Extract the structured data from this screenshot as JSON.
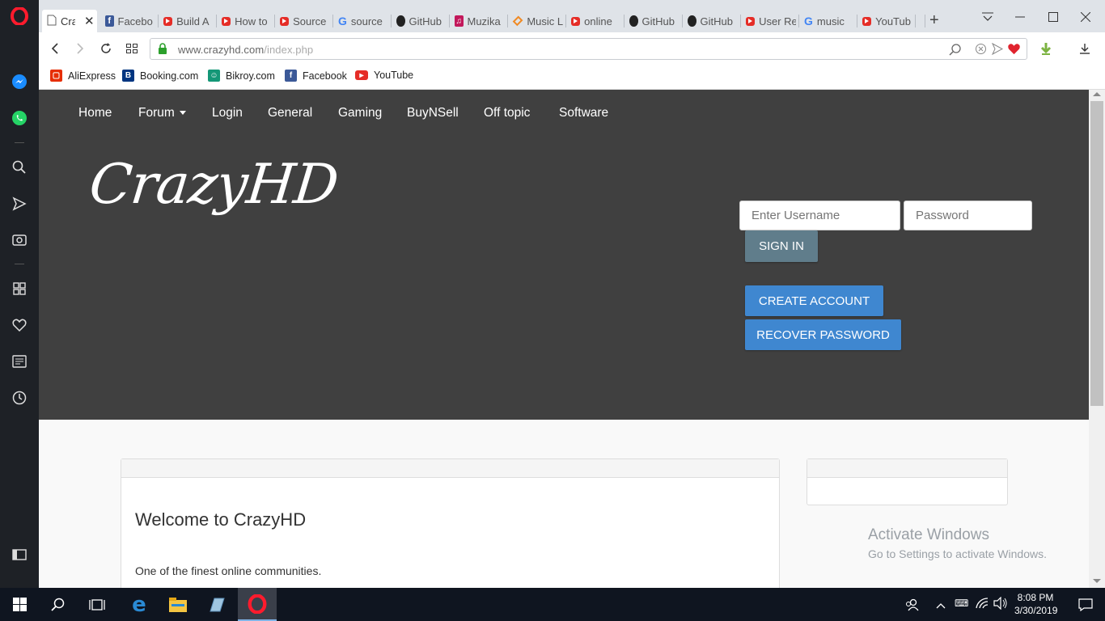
{
  "browser": {
    "tabs": [
      {
        "label": "Cra",
        "icon": "page-icon",
        "active": true
      },
      {
        "label": "Facebo",
        "icon": "facebook-icon"
      },
      {
        "label": "Build A",
        "icon": "youtube-icon"
      },
      {
        "label": "How to",
        "icon": "youtube-icon"
      },
      {
        "label": "Source",
        "icon": "youtube-icon"
      },
      {
        "label": "source",
        "icon": "google-icon"
      },
      {
        "label": "GitHub",
        "icon": "github-icon"
      },
      {
        "label": "Muzika",
        "icon": "music-icon"
      },
      {
        "label": "Music L",
        "icon": "music-diamond-icon"
      },
      {
        "label": "online",
        "icon": "youtube-icon"
      },
      {
        "label": "GitHub",
        "icon": "github-icon"
      },
      {
        "label": "GitHub",
        "icon": "github-icon"
      },
      {
        "label": "User Re",
        "icon": "youtube-icon"
      },
      {
        "label": "music",
        "icon": "google-icon"
      },
      {
        "label": "YouTub",
        "icon": "youtube-icon"
      }
    ],
    "new_tab_glyph": "+",
    "url_host": "www.crazyhd.com",
    "url_path": "/index.php",
    "bookmarks": [
      {
        "label": "AliExpress",
        "icon": "aliexpress-icon",
        "color": "#e62e04"
      },
      {
        "label": "Booking.com",
        "icon": "booking-icon",
        "color": "#003580"
      },
      {
        "label": "Bikroy.com",
        "icon": "bikroy-icon",
        "color": "#149777"
      },
      {
        "label": "Facebook",
        "icon": "facebook-icon",
        "color": "#3b5998"
      },
      {
        "label": "YouTube",
        "icon": "youtube-icon",
        "color": "#e52d27"
      }
    ]
  },
  "site": {
    "nav": [
      "Home",
      "Forum",
      "Login",
      "General",
      "Gaming",
      "BuyNSell",
      "Off topic",
      "Software"
    ],
    "logo": "CrazyHD",
    "login": {
      "username_placeholder": "Enter Username",
      "password_placeholder": "Password",
      "sign_in": "SIGN IN",
      "create_account": "CREATE ACCOUNT",
      "recover_password": "RECOVER PASSWORD"
    },
    "welcome_title": "Welcome to CrazyHD",
    "welcome_text": "One of the finest online communities."
  },
  "watermark": {
    "title": "Activate Windows",
    "subtitle": "Go to Settings to activate Windows."
  },
  "taskbar": {
    "time": "8:08 PM",
    "date": "3/30/2019"
  },
  "colors": {
    "hero_bg": "#404040",
    "sign_in_btn": "#607d8b",
    "primary_btn": "#3f87d0",
    "opera_red": "#ff1b2d"
  }
}
